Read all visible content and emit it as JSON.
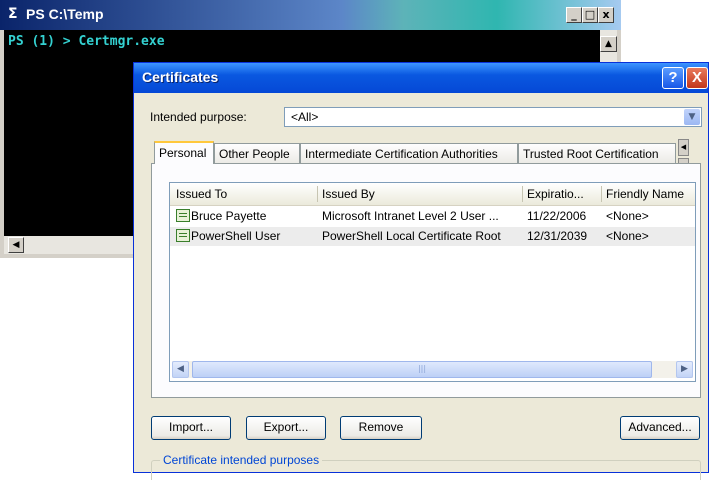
{
  "console": {
    "title_icon": "powershell-icon",
    "title": "PS C:\\Temp",
    "prompt_line": "PS (1) > Certmgr.exe",
    "min_glyph": "_",
    "max_glyph": "□",
    "close_glyph": "x"
  },
  "dialog": {
    "title": "Certificates",
    "help_glyph": "?",
    "close_glyph": "X",
    "intended_purpose_label": "Intended purpose:",
    "intended_purpose_value": "<All>",
    "tabs": [
      {
        "label": "Personal",
        "active": true
      },
      {
        "label": "Other People",
        "active": false
      },
      {
        "label": "Intermediate Certification Authorities",
        "active": false
      },
      {
        "label": "Trusted Root Certification",
        "active": false
      }
    ],
    "columns": [
      "Issued To",
      "Issued By",
      "Expiratio...",
      "Friendly Name"
    ],
    "rows": [
      {
        "issued_to": "Bruce Payette",
        "issued_by": "Microsoft Intranet Level 2 User ...",
        "expiration": "11/22/2006",
        "friendly_name": "<None>"
      },
      {
        "issued_to": "PowerShell User",
        "issued_by": "PowerShell Local Certificate Root",
        "expiration": "12/31/2039",
        "friendly_name": "<None>"
      }
    ],
    "buttons": {
      "import": "Import...",
      "export": "Export...",
      "remove": "Remove",
      "advanced": "Advanced..."
    },
    "group_label": "Certificate intended purposes"
  },
  "colors": {
    "console_text": "#34d1d1",
    "xp_title_blue": "#0548d6",
    "active_tab_accent": "#ffc83c"
  }
}
